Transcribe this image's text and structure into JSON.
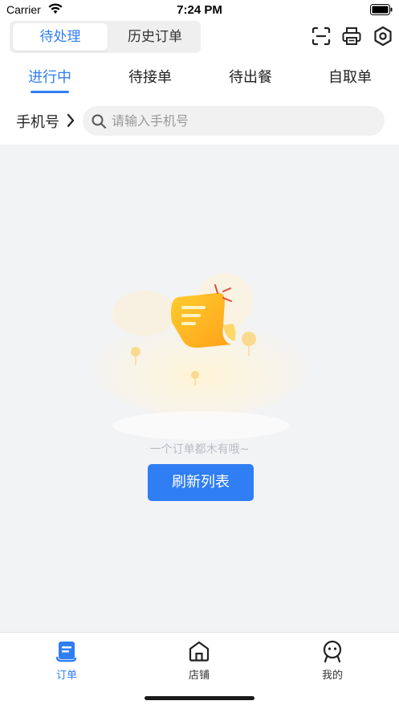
{
  "status_bar": {
    "carrier": "Carrier",
    "time": "7:24 PM"
  },
  "segmented": {
    "active": "待处理",
    "inactive": "历史订单"
  },
  "toolbar": {
    "icons": [
      "scan-icon",
      "printer-icon",
      "settings-icon"
    ]
  },
  "tabs": [
    "进行中",
    "待接单",
    "待出餐",
    "自取单"
  ],
  "search": {
    "label": "手机号",
    "placeholder": "请输入手机号",
    "value": ""
  },
  "empty_state": {
    "message": "一个订单都木有哦~",
    "button": "刷新列表"
  },
  "tabbar": {
    "items": [
      {
        "label": "订单",
        "icon": "order-icon",
        "active": true
      },
      {
        "label": "店铺",
        "icon": "store-icon",
        "active": false
      },
      {
        "label": "我的",
        "icon": "profile-icon",
        "active": false
      }
    ]
  },
  "colors": {
    "accent": "#2f7ef4",
    "background": "#f2f3f5",
    "illustration": "#ffb300"
  }
}
